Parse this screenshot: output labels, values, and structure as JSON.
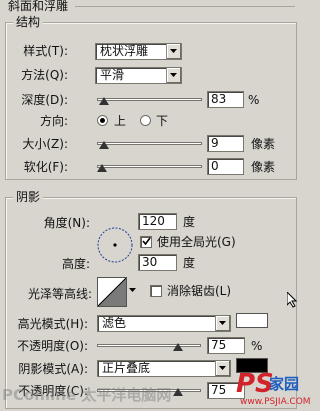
{
  "top_tab": "斜面和浮雕",
  "structure": {
    "title": "结构",
    "style_label": "样式(T):",
    "style_value": "枕状浮雕",
    "method_label": "方法(Q):",
    "method_value": "平滑",
    "depth_label": "深度(D):",
    "depth_value": "83",
    "depth_unit": "%",
    "depth_level": 0.03,
    "direction_label": "方向:",
    "direction_up": "上",
    "direction_down": "下",
    "direction_selected": "上",
    "size_label": "大小(Z):",
    "size_value": "9",
    "size_unit": "像素",
    "size_level": 0.03,
    "soften_label": "软化(F):",
    "soften_value": "0",
    "soften_unit": "像素",
    "soften_level": 0.0
  },
  "shadow": {
    "title": "阴影",
    "angle_label": "角度(N):",
    "angle_value": "120",
    "angle_unit": "度",
    "global_light_label": "使用全局光(G)",
    "global_light_checked": true,
    "altitude_label": "高度:",
    "altitude_value": "30",
    "altitude_unit": "度",
    "gloss_contour_label": "光泽等高线:",
    "anti_alias_label": "消除锯齿(L)",
    "anti_alias_checked": false,
    "highlight_mode_label": "高光模式(H):",
    "highlight_mode_value": "滤色",
    "highlight_color": "#ffffff",
    "highlight_opacity_label": "不透明度(O):",
    "highlight_opacity_value": "75",
    "highlight_opacity_unit": "%",
    "highlight_opacity_level": 0.75,
    "shadow_mode_label": "阴影模式(A):",
    "shadow_mode_value": "正片叠底",
    "shadow_color": "#000000",
    "shadow_opacity_label": "不透明度(C):",
    "shadow_opacity_value": "75",
    "shadow_opacity_unit": "%"
  },
  "watermarks": {
    "left": "PConline 太平洋电脑网",
    "right_brand": "PS",
    "right_suffix": "家园",
    "right_url": "www.PSJIA.COM"
  },
  "colors": {
    "panel_bg": "#d8d5cf",
    "watermark_red": "#d2232a",
    "watermark_blue": "#1f5fbf"
  }
}
